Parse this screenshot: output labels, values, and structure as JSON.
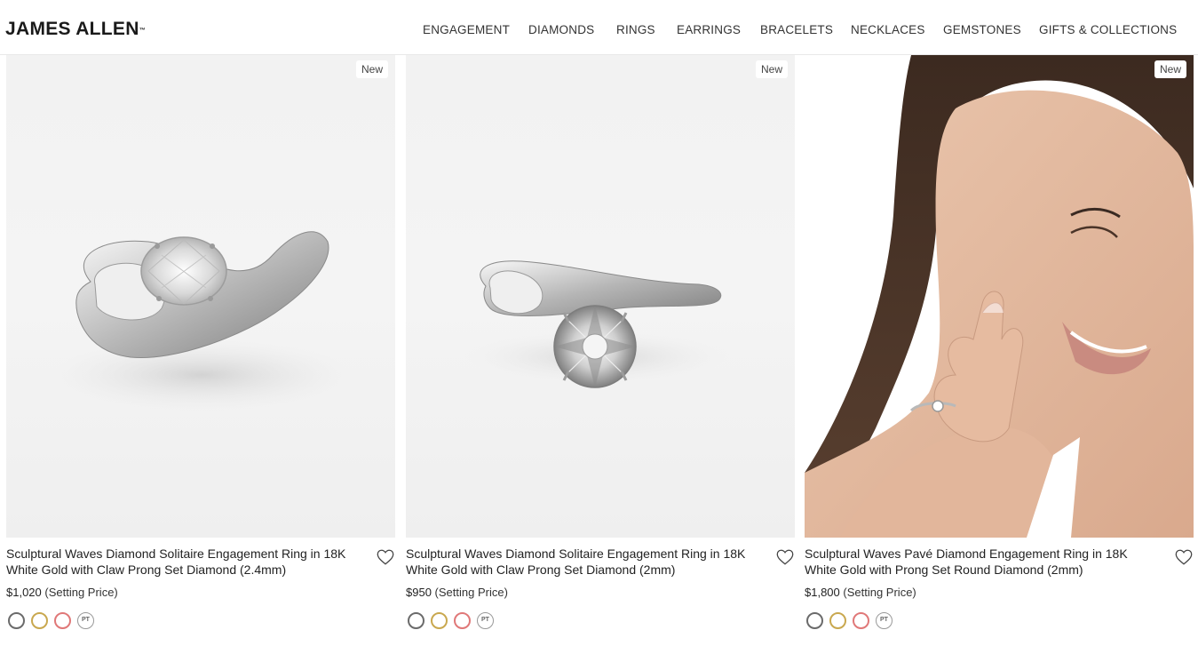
{
  "header": {
    "logo": "JAMES ALLEN",
    "logo_mark": "™",
    "nav": [
      "ENGAGEMENT",
      "DIAMONDS",
      "RINGS",
      "EARRINGS",
      "BRACELETS",
      "NECKLACES",
      "GEMSTONES",
      "GIFTS & COLLECTIONS"
    ]
  },
  "products": [
    {
      "badge": "New",
      "title": "Sculptural Waves Diamond Solitaire Engagement Ring in 18K White Gold with Claw Prong Set Diamond (2.4mm)",
      "price": "$1,020",
      "price_suffix": "(Setting Price)",
      "image": "oval-diamond-ring",
      "swatch_colors": [
        "#6b6b6b",
        "#c9a84f",
        "#e07878"
      ],
      "swatch_pt": "PT"
    },
    {
      "badge": "New",
      "title": "Sculptural Waves Diamond Solitaire Engagement Ring in 18K White Gold with Claw Prong Set Diamond (2mm)",
      "price": "$950",
      "price_suffix": "(Setting Price)",
      "image": "round-diamond-ring",
      "swatch_colors": [
        "#6b6b6b",
        "#c9a84f",
        "#e07878"
      ],
      "swatch_pt": "PT"
    },
    {
      "badge": "New",
      "title": "Sculptural Waves Pavé Diamond Engagement Ring in 18K White Gold with Prong Set Round Diamond (2mm)",
      "price": "$1,800",
      "price_suffix": "(Setting Price)",
      "image": "model-wearing-ring",
      "swatch_colors": [
        "#6b6b6b",
        "#c9a84f",
        "#e07878"
      ],
      "swatch_pt": "PT"
    }
  ],
  "icons": {
    "wishlist": "heart-icon"
  }
}
